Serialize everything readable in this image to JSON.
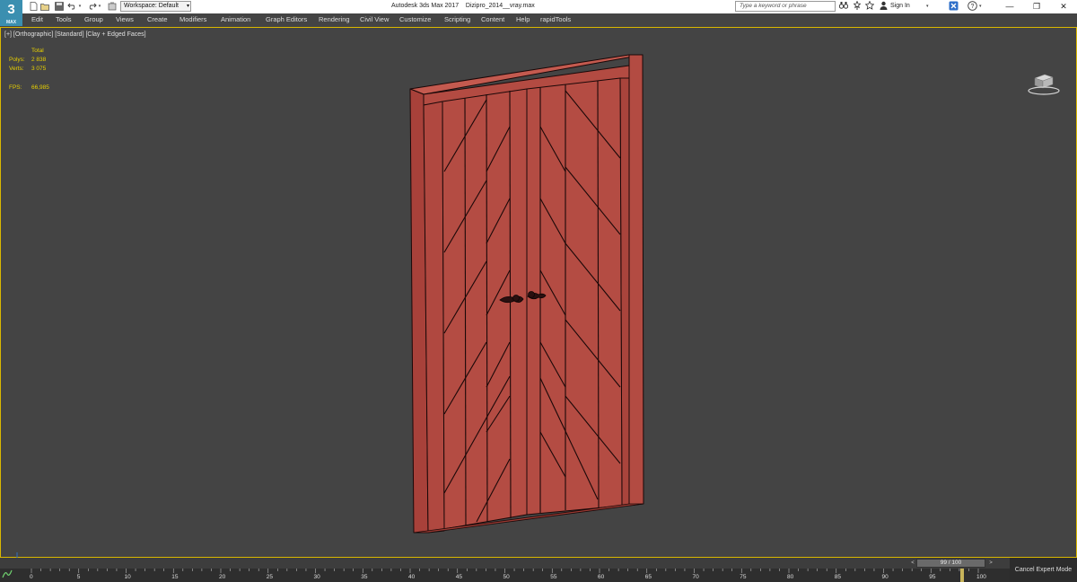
{
  "app": {
    "logo_text": "3",
    "logo_sub": "MAX",
    "window_title": "Autodesk 3ds Max 2017",
    "file_name": "Dizipro_2014__vray.max",
    "workspace_label": "Workspace: Default"
  },
  "titlebar": {
    "search_placeholder": "Type a keyword or phrase",
    "sign_in_label": "Sign In",
    "icons": [
      "new-icon",
      "open-icon",
      "save-icon",
      "undo-icon",
      "redo-icon",
      "project-icon",
      "search-icon",
      "binoculars-icon",
      "star-icon",
      "user-icon",
      "exchange-icon",
      "help-icon"
    ]
  },
  "menu": {
    "items": [
      "Edit",
      "Tools",
      "Group",
      "Views",
      "Create",
      "Modifiers",
      "Animation",
      "Graph Editors",
      "Rendering",
      "Civil View",
      "Customize",
      "Scripting",
      "Content",
      "Help",
      "rapidTools"
    ]
  },
  "viewport": {
    "label": "[+] [Orthographic] [Standard] [Clay + Edged Faces]",
    "stats": {
      "header": "Total",
      "polys_label": "Polys:",
      "polys_value": "2 838",
      "verts_label": "Verts:",
      "verts_value": "3 075",
      "fps_label": "FPS:",
      "fps_value": "66,985"
    },
    "object_color": "#b5483f",
    "edge_color": "#1a0808",
    "border_color": "#d9b700"
  },
  "timeline": {
    "frame_display": "99 / 100",
    "prev_label": "<",
    "next_label": ">",
    "ticks": [
      "0",
      "5",
      "10",
      "15",
      "20",
      "25",
      "30",
      "35",
      "40",
      "45",
      "50",
      "55",
      "60",
      "65",
      "70",
      "75",
      "80",
      "85",
      "90",
      "95",
      "100"
    ],
    "current_frame": 99,
    "cancel_expert_label": "Cancel Expert Mode"
  }
}
